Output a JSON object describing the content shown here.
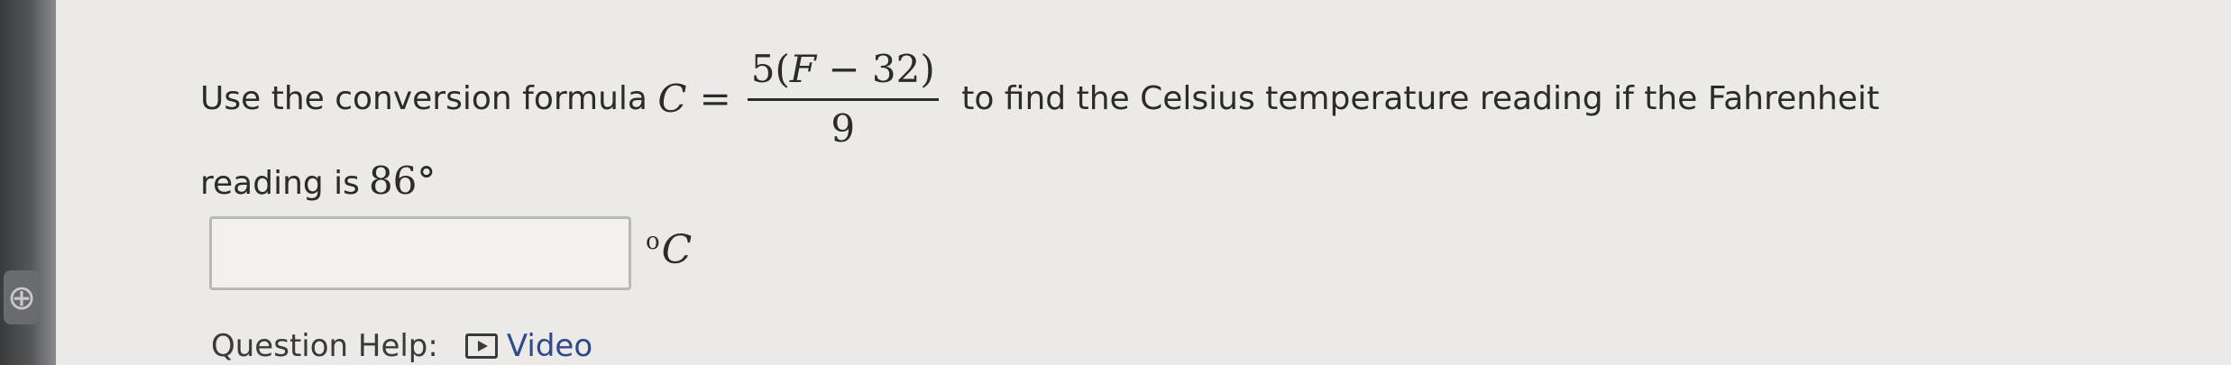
{
  "question": {
    "text_before": "Use the conversion formula ",
    "formula_lhs": "C",
    "formula_eq": "=",
    "formula_num_pre": "5(",
    "formula_num_var": "F",
    "formula_num_post": " − 32)",
    "formula_den": "9",
    "text_after": " to find the Celsius temperature reading if the Fahrenheit",
    "line2_text": "reading is",
    "fahrenheit_value": "86°"
  },
  "answer": {
    "value": "",
    "placeholder": "",
    "unit_degree": "o",
    "unit_letter": "C"
  },
  "help": {
    "label": "Question Help:",
    "video_label": "Video"
  },
  "icons": {
    "video": "play-video-icon",
    "sidebar": "globe-icon"
  }
}
